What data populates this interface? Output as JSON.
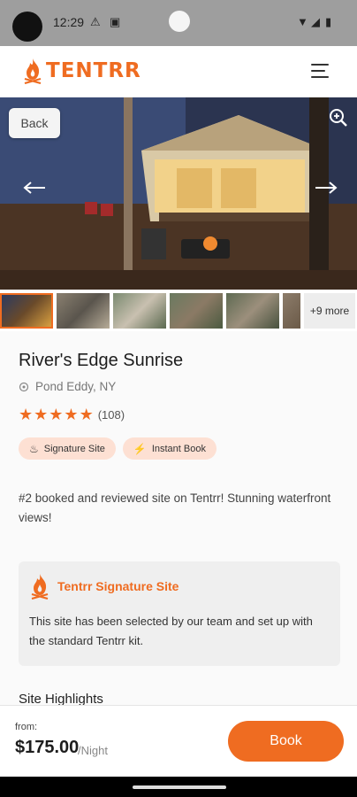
{
  "status": {
    "time": "12:29"
  },
  "header": {
    "brand": "TENTRR"
  },
  "hero": {
    "back_label": "Back"
  },
  "thumbs": {
    "more_label": "+9 more"
  },
  "listing": {
    "title": "River's Edge Sunrise",
    "location": "Pond Eddy, NY",
    "rating_stars": 5,
    "review_count": "(108)",
    "badges": [
      "Signature Site",
      "Instant Book"
    ],
    "description": "#2 booked and reviewed site on Tentrr! Stunning waterfront views!"
  },
  "signature": {
    "title": "Tentrr Signature Site",
    "text": "This site has been selected by our team and set up with the standard Tentrr kit."
  },
  "highlights_heading": "Site Highlights",
  "footer": {
    "from_label": "from:",
    "price": "$175.00",
    "per": "/Night",
    "book_label": "Book"
  },
  "colors": {
    "accent": "#ef6c21",
    "badge_bg": "#fde0d3"
  }
}
